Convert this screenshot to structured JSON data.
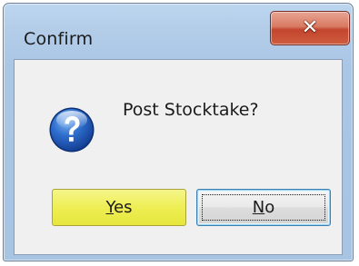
{
  "dialog": {
    "title": "Confirm",
    "close_glyph": "✕",
    "message": "Post Stocktake?",
    "icon": "question-icon",
    "buttons": {
      "yes": {
        "mnemonic": "Y",
        "rest": "es"
      },
      "no": {
        "mnemonic": "N",
        "rest": "o"
      }
    }
  },
  "colors": {
    "title_bar": "#b3cde9",
    "close_button": "#c2452d",
    "yes_button": "#eeee55",
    "no_button_border": "#3c7fb1",
    "client_background": "#f0f0f0"
  }
}
